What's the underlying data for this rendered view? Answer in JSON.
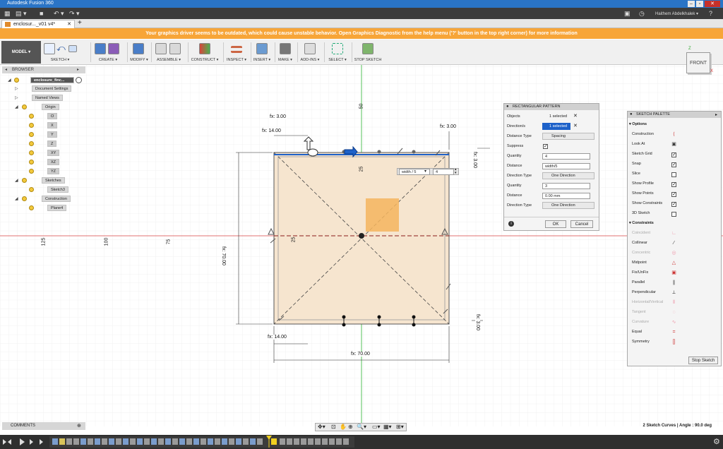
{
  "app": {
    "title": "Autodesk Fusion 360",
    "user": "Haithem Abdelkhalek"
  },
  "tab": {
    "name": "enclosur..._v01 v4*",
    "add": "+"
  },
  "banner": {
    "text": "Your graphics driver seems to be outdated, which could cause unstable behavior. Open Graphics Diagnostic from the help menu ('?' button in the top right corner) for more information"
  },
  "toolbar": {
    "workspace": "MODEL ▾",
    "groups": [
      "SKETCH ▾",
      "CREATE ▾",
      "MODIFY ▾",
      "ASSEMBLE ▾",
      "CONSTRUCT ▾",
      "INSPECT ▾",
      "INSERT ▾",
      "MAKE ▾",
      "ADD-INS ▾",
      "SELECT ▾",
      "STOP SKETCH"
    ]
  },
  "browser": {
    "title": "BROWSER",
    "root": "enclosure_finc...",
    "items": [
      "Document Settings",
      "Named Views",
      "Origin",
      "O",
      "X",
      "Y",
      "Z",
      "XY",
      "XZ",
      "YZ",
      "Sketches",
      "Sketch3",
      "Construction",
      "Plane4"
    ]
  },
  "viewcube": {
    "label": "FRONT",
    "axis_x": "X",
    "axis_z": "Z"
  },
  "dimensions": {
    "fx_300_a": "fx: 3.00",
    "fx_1400_a": "fx: 14.00",
    "fx_300_b": "fx: 3.00",
    "right_300_a": "fx: 3.00",
    "right_300_b": "fx: 3.00",
    "left_7000": "fx: 70.00",
    "fx_1400_b": "fx: 14.00",
    "bottom_7000": "fx: 70.00"
  },
  "ruler": {
    "v50": "50",
    "v25": "25",
    "h125": "125",
    "h100": "100",
    "h75": "75",
    "h25": "25"
  },
  "inline_input": {
    "expr": "width / 5",
    "count": "4"
  },
  "pattern_dialog": {
    "title": "RECTANGULAR PATTERN",
    "rows": [
      {
        "label": "Objects",
        "value": "1 selected"
      },
      {
        "label": "Direction/s",
        "value": "1 selected"
      },
      {
        "label": "Distance Type",
        "value": "Spacing"
      },
      {
        "label": "Suppress",
        "value": ""
      },
      {
        "label": "Quantity",
        "value": "4"
      },
      {
        "label": "Distance",
        "value": "width/5"
      },
      {
        "label": "Direction Type",
        "value": "One Direction"
      },
      {
        "label": "Quantity",
        "value": "3"
      },
      {
        "label": "Distance",
        "value": "0.00 mm"
      },
      {
        "label": "Direction Type",
        "value": "One Direction"
      }
    ],
    "ok": "OK",
    "cancel": "Cancel"
  },
  "sketch_palette": {
    "title": "SKETCH PALETTE",
    "options_header": "Options",
    "options": [
      {
        "label": "Construction",
        "icon": "construction-icon"
      },
      {
        "label": "Look At",
        "icon": "look-at-icon"
      },
      {
        "label": "Sketch Grid",
        "checked": true
      },
      {
        "label": "Snap",
        "checked": true
      },
      {
        "label": "Slice",
        "checked": false
      },
      {
        "label": "Show Profile",
        "checked": true
      },
      {
        "label": "Show Points",
        "checked": true
      },
      {
        "label": "Show Constraints",
        "checked": true
      },
      {
        "label": "3D Sketch",
        "checked": false
      }
    ],
    "constraints_header": "Constraints",
    "constraints": [
      {
        "label": "Coincident",
        "disabled": true
      },
      {
        "label": "Collinear",
        "disabled": false
      },
      {
        "label": "Concentric",
        "disabled": true
      },
      {
        "label": "Midpoint",
        "disabled": false
      },
      {
        "label": "Fix/UnFix",
        "disabled": false
      },
      {
        "label": "Parallel",
        "disabled": false
      },
      {
        "label": "Perpendicular",
        "disabled": false
      },
      {
        "label": "Horizontal/Vertical",
        "disabled": true
      },
      {
        "label": "Tangent",
        "disabled": true
      },
      {
        "label": "Curvature",
        "disabled": true
      },
      {
        "label": "Equal",
        "disabled": false
      },
      {
        "label": "Symmetry",
        "disabled": false
      }
    ],
    "stop": "Stop Sketch"
  },
  "comments": {
    "label": "COMMENTS"
  },
  "status": {
    "text": "2 Sketch Curves | Angle : 90.0 deg"
  }
}
